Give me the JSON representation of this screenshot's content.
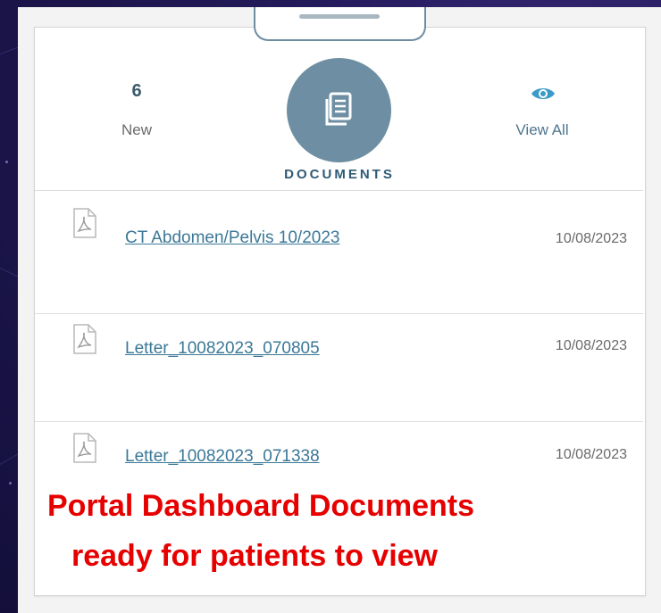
{
  "widget": {
    "new_count": "6",
    "new_label": "New",
    "title": "DOCUMENTS",
    "view_all_label": "View All"
  },
  "documents": [
    {
      "name": "CT Abdomen/Pelvis 10/2023",
      "date": "10/08/2023"
    },
    {
      "name": "Letter_10082023_070805",
      "date": "10/08/2023"
    },
    {
      "name": "Letter_10082023_071338",
      "date": "10/08/2023"
    }
  ],
  "overlay": {
    "line1": "Portal Dashboard Documents",
    "line2": "ready for patients to view"
  },
  "colors": {
    "accent": "#6e8fa3",
    "title": "#2e5a75",
    "link": "#3b7897",
    "overlay": "#e60000"
  },
  "icons": {
    "documents": "documents-icon",
    "view_all": "eye-icon",
    "file": "pdf-file-icon"
  }
}
